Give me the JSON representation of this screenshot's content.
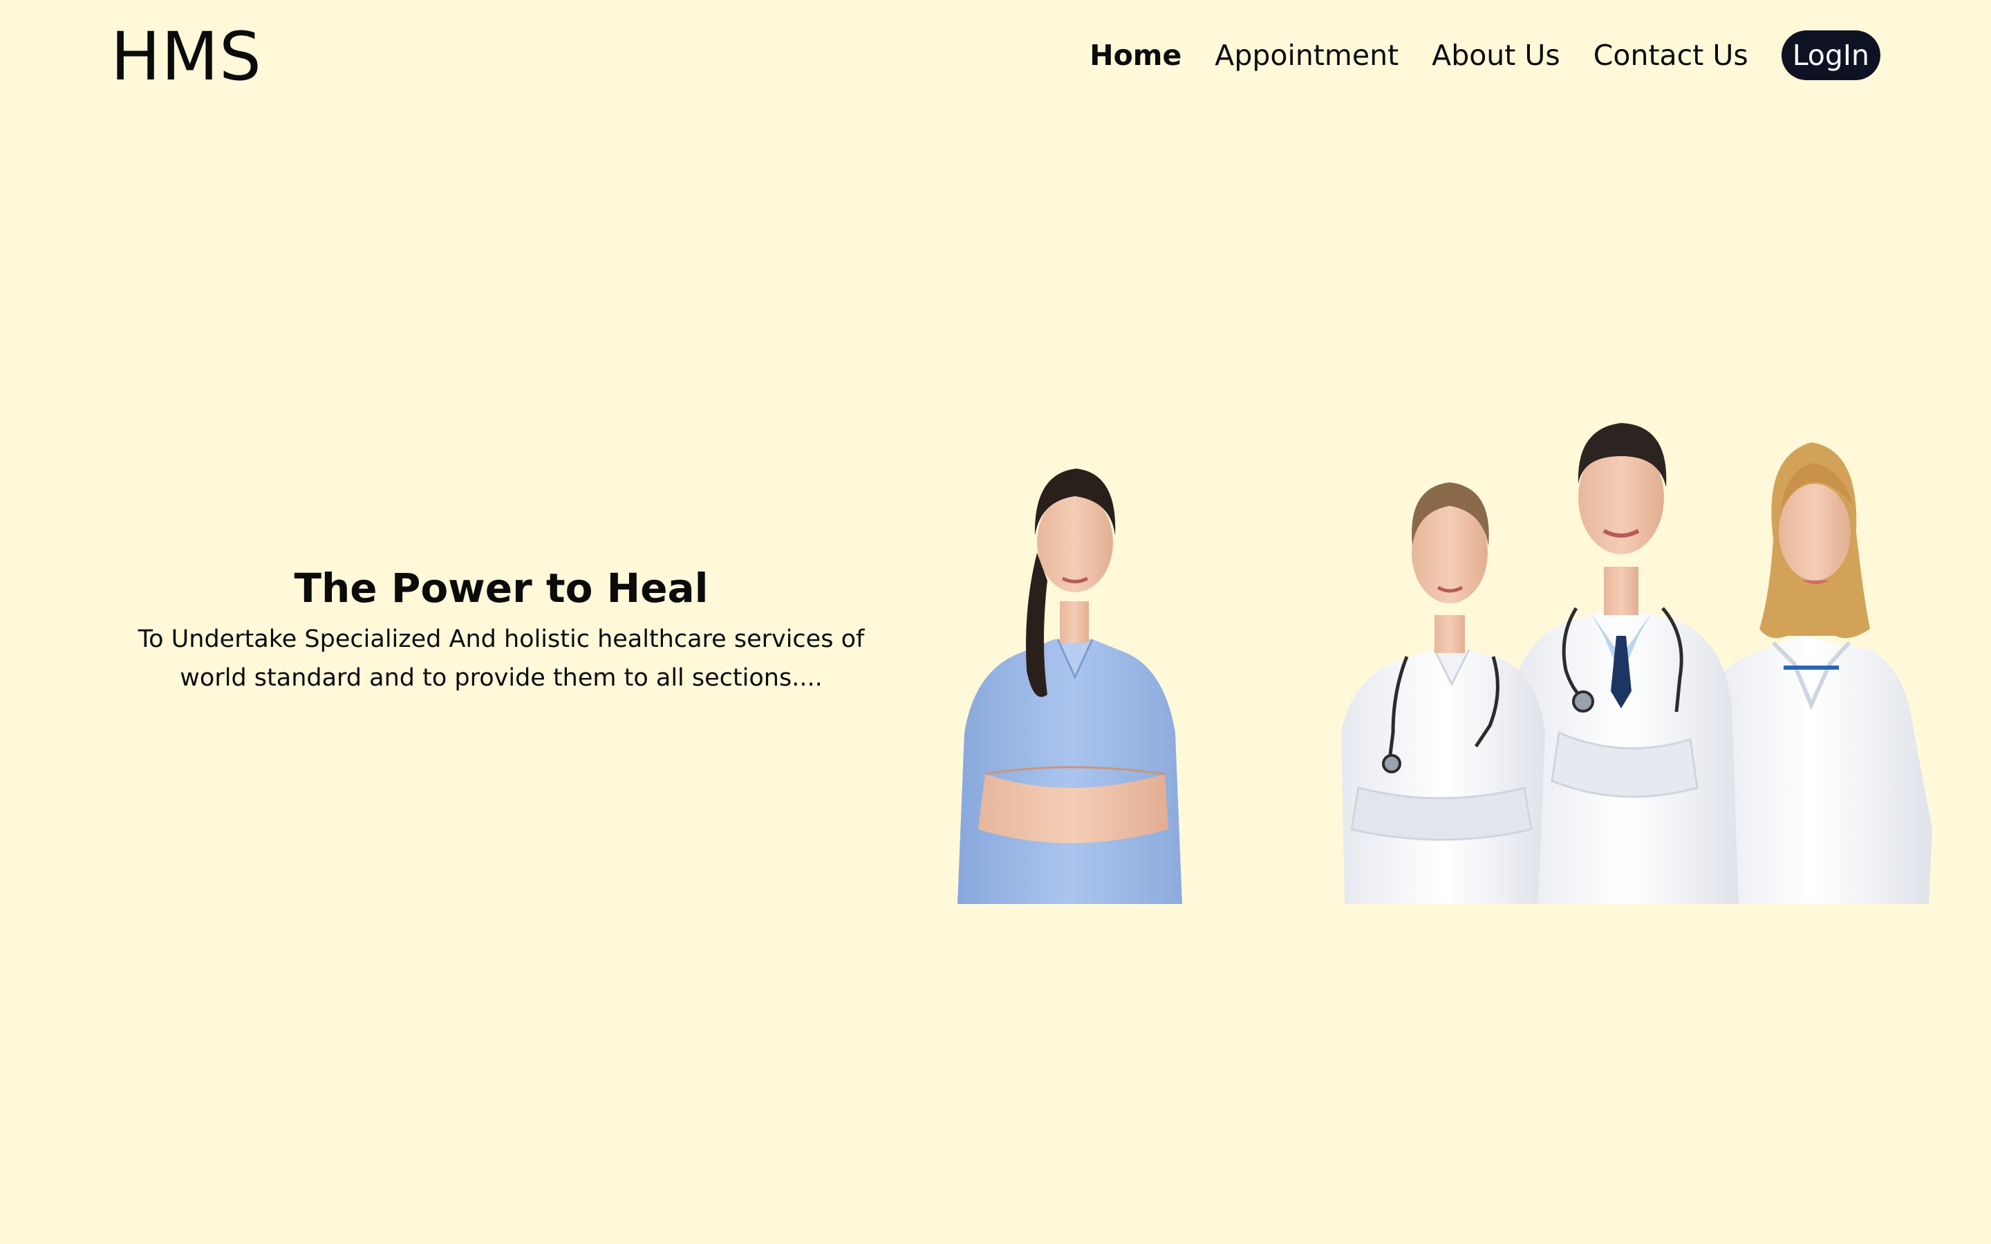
{
  "brand": {
    "logo": "HMS"
  },
  "nav": {
    "items": [
      {
        "label": "Home",
        "active": true
      },
      {
        "label": "Appointment",
        "active": false
      },
      {
        "label": "About Us",
        "active": false
      },
      {
        "label": "Contact Us",
        "active": false
      }
    ],
    "login_label": "LogIn"
  },
  "hero": {
    "title": "The Power to Heal",
    "subtitle_line1": "To Undertake Specialized And holistic healthcare services of",
    "subtitle_line2": "world standard and to provide them to all sections...."
  },
  "colors": {
    "background": "#FFF9DA",
    "login_button": "#0F1223",
    "text": "#0B0B0B"
  }
}
